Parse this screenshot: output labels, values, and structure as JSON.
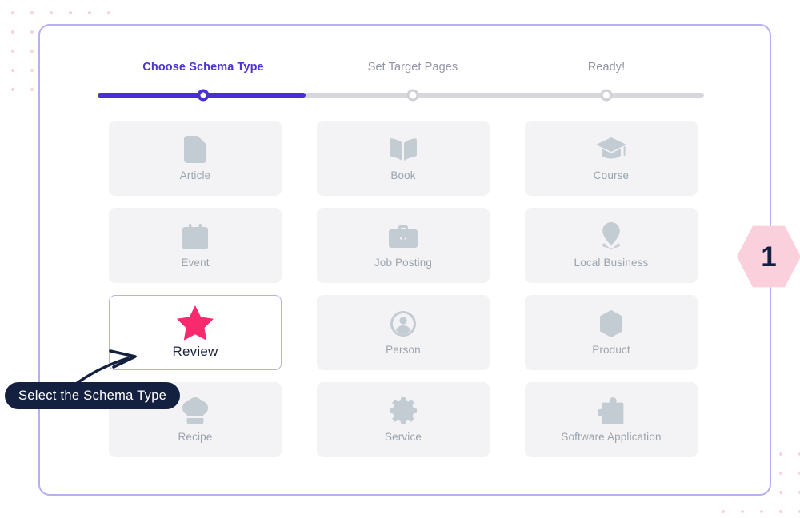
{
  "stepper": {
    "steps": [
      {
        "label": "Choose Schema Type",
        "state": "active"
      },
      {
        "label": "Set Target Pages",
        "state": "idle"
      },
      {
        "label": "Ready!",
        "state": "idle"
      }
    ],
    "active_color": "#4f33d6",
    "idle_color": "#9295a3",
    "track_color": "#d8d8dc",
    "fill_color": "#4a2fd4"
  },
  "schema_types": [
    {
      "label": "Article",
      "icon": "document-icon",
      "selected": false
    },
    {
      "label": "Book",
      "icon": "open-book-icon",
      "selected": false
    },
    {
      "label": "Course",
      "icon": "graduation-cap-icon",
      "selected": false
    },
    {
      "label": "Event",
      "icon": "calendar-star-icon",
      "selected": false
    },
    {
      "label": "Job Posting",
      "icon": "briefcase-icon",
      "selected": false
    },
    {
      "label": "Local Business",
      "icon": "map-pin-icon",
      "selected": false
    },
    {
      "label": "Review",
      "icon": "star-icon",
      "selected": true
    },
    {
      "label": "Person",
      "icon": "user-circle-icon",
      "selected": false
    },
    {
      "label": "Product",
      "icon": "box-icon",
      "selected": false
    },
    {
      "label": "Recipe",
      "icon": "chef-hat-icon",
      "selected": false
    },
    {
      "label": "Service",
      "icon": "gear-wrench-icon",
      "selected": false
    },
    {
      "label": "Software Application",
      "icon": "puzzle-piece-icon",
      "selected": false
    }
  ],
  "annotation": {
    "callout_text": "Select the Schema Type",
    "callout_bg": "#14203f",
    "callout_text_color": "#ffffff",
    "arrow_color": "#14203f"
  },
  "step_badge": {
    "number": "1",
    "bg": "#fbd0dd",
    "text_color": "#14203f"
  },
  "colors": {
    "panel_border": "#b9aef2",
    "card_bg": "#f3f3f6",
    "card_icon": "#c3cbd3",
    "card_label": "#9aa4ad",
    "selected_star": "#f8296d",
    "selected_label": "#1b2340",
    "decor_dots": "#fbd3de"
  }
}
